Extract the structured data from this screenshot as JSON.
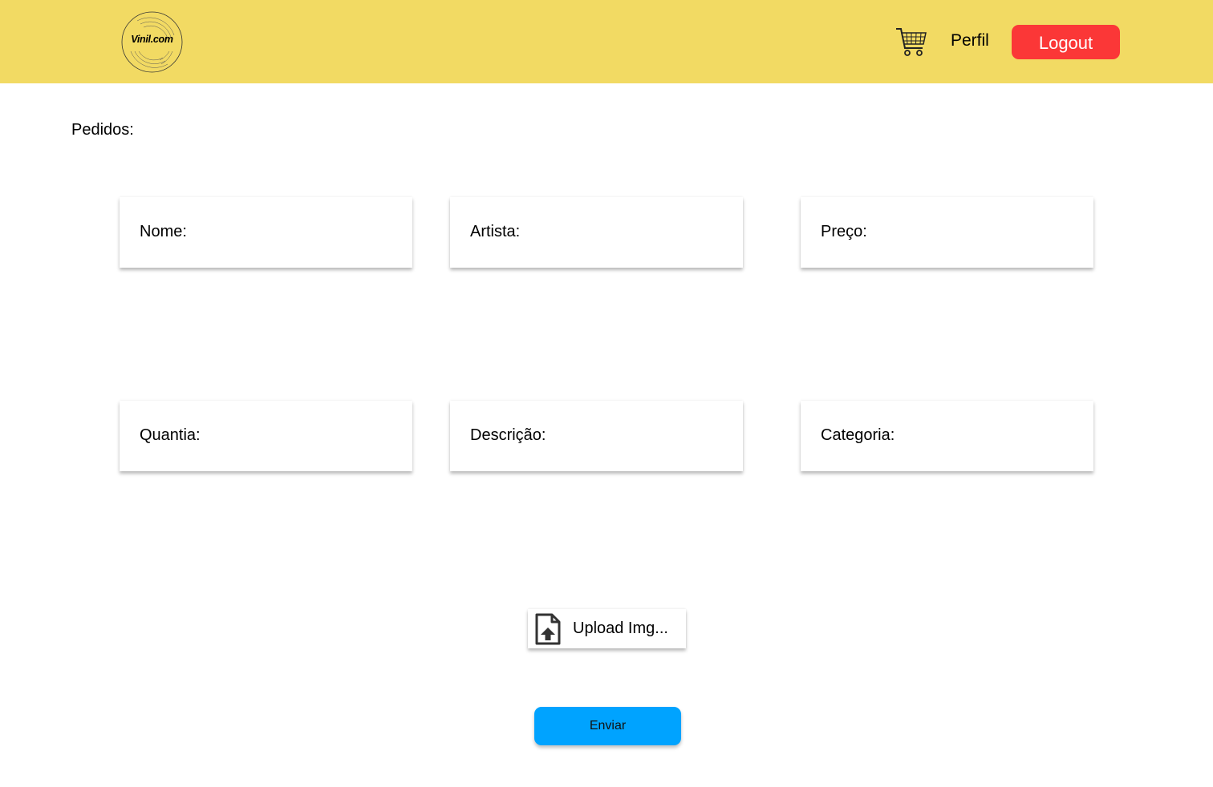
{
  "header": {
    "logo_text": "Vinil.com",
    "perfil_label": "Perfil",
    "logout_label": "Logout",
    "background_color": "#f2da63",
    "logout_color": "#fb3737"
  },
  "page": {
    "section_title": "Pedidos:"
  },
  "form": {
    "fields": [
      {
        "label": "Nome:"
      },
      {
        "label": "Artista:"
      },
      {
        "label": "Preço:"
      },
      {
        "label": "Quantia:"
      },
      {
        "label": "Descrição:"
      },
      {
        "label": "Categoria:"
      }
    ],
    "upload_label": "Upload Img...",
    "submit_label": "Enviar",
    "submit_color": "#00a3ff"
  },
  "icons": {
    "cart": "shopping-cart-icon",
    "upload": "file-upload-icon",
    "logo": "vinyl-record-icon"
  }
}
